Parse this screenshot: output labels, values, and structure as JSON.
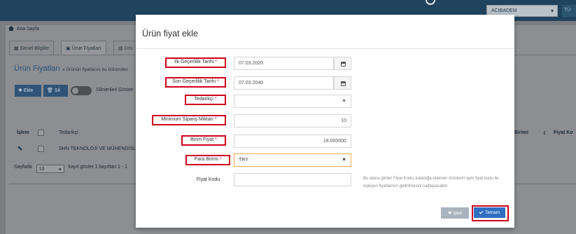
{
  "topbar": {
    "branch_select": "ACIBADEM",
    "extra": "TÜ"
  },
  "breadcrumb": {
    "label": "Ana Sayfa"
  },
  "tabs": [
    {
      "label": "Genel Bilgiler"
    },
    {
      "label": "Ürün Fiyatları"
    },
    {
      "label": "Ürü"
    }
  ],
  "section": {
    "title": "Ürün Fiyatları",
    "subtitle": "» Ürünün fiyatlarını bu bölümden"
  },
  "toolbar": {
    "add_label": "Ekle",
    "delete_label": "Sil",
    "toggle_label": "Silinenleri Göster"
  },
  "table": {
    "headers": {
      "action": "İşlem",
      "supplier": "Tedarikçi",
      "unit": "Birimi",
      "price_code": "Fiyat Ko"
    },
    "rows": [
      {
        "supplier": "SHN TEKNOLOJİ VE MÜHENDİSLİ"
      }
    ]
  },
  "pager": {
    "prefix": "Sayfada",
    "page_size": "10",
    "suffix": "kayıt göster   1 kayıttan 1 - 1"
  },
  "modal": {
    "title": "Ürün fiyat ekle",
    "fields": {
      "start_date": {
        "label": "İlk Geçerlilik Tarihi",
        "value": "07.03.2020"
      },
      "end_date": {
        "label": "Son Geçerlilik Tarihi",
        "value": "07.03.2040"
      },
      "supplier": {
        "label": "Tedarikçi",
        "value": ""
      },
      "min_qty": {
        "label": "Minimum Sipariş Miktarı",
        "value": "10"
      },
      "unit_price": {
        "label": "Birim Fiyat",
        "value": "18.000000"
      },
      "currency": {
        "label": "Para Birimi",
        "value": "TRY"
      },
      "price_code": {
        "label": "Fiyat Kodu",
        "value": ""
      }
    },
    "required_mark": "*",
    "hint": "Bu alana girilen Fiyat Kodu, kataloğa eklenen ürünlerin aynı fiyat kodu ile eşleşen fiyatlarının getirilmesini sağlayacaktır.",
    "cancel_label": "İptal",
    "ok_label": "Tamam"
  },
  "colors": {
    "highlight_box": "#d0021b",
    "primary_button": "#2f6fc0",
    "topbar": "#20435e"
  }
}
